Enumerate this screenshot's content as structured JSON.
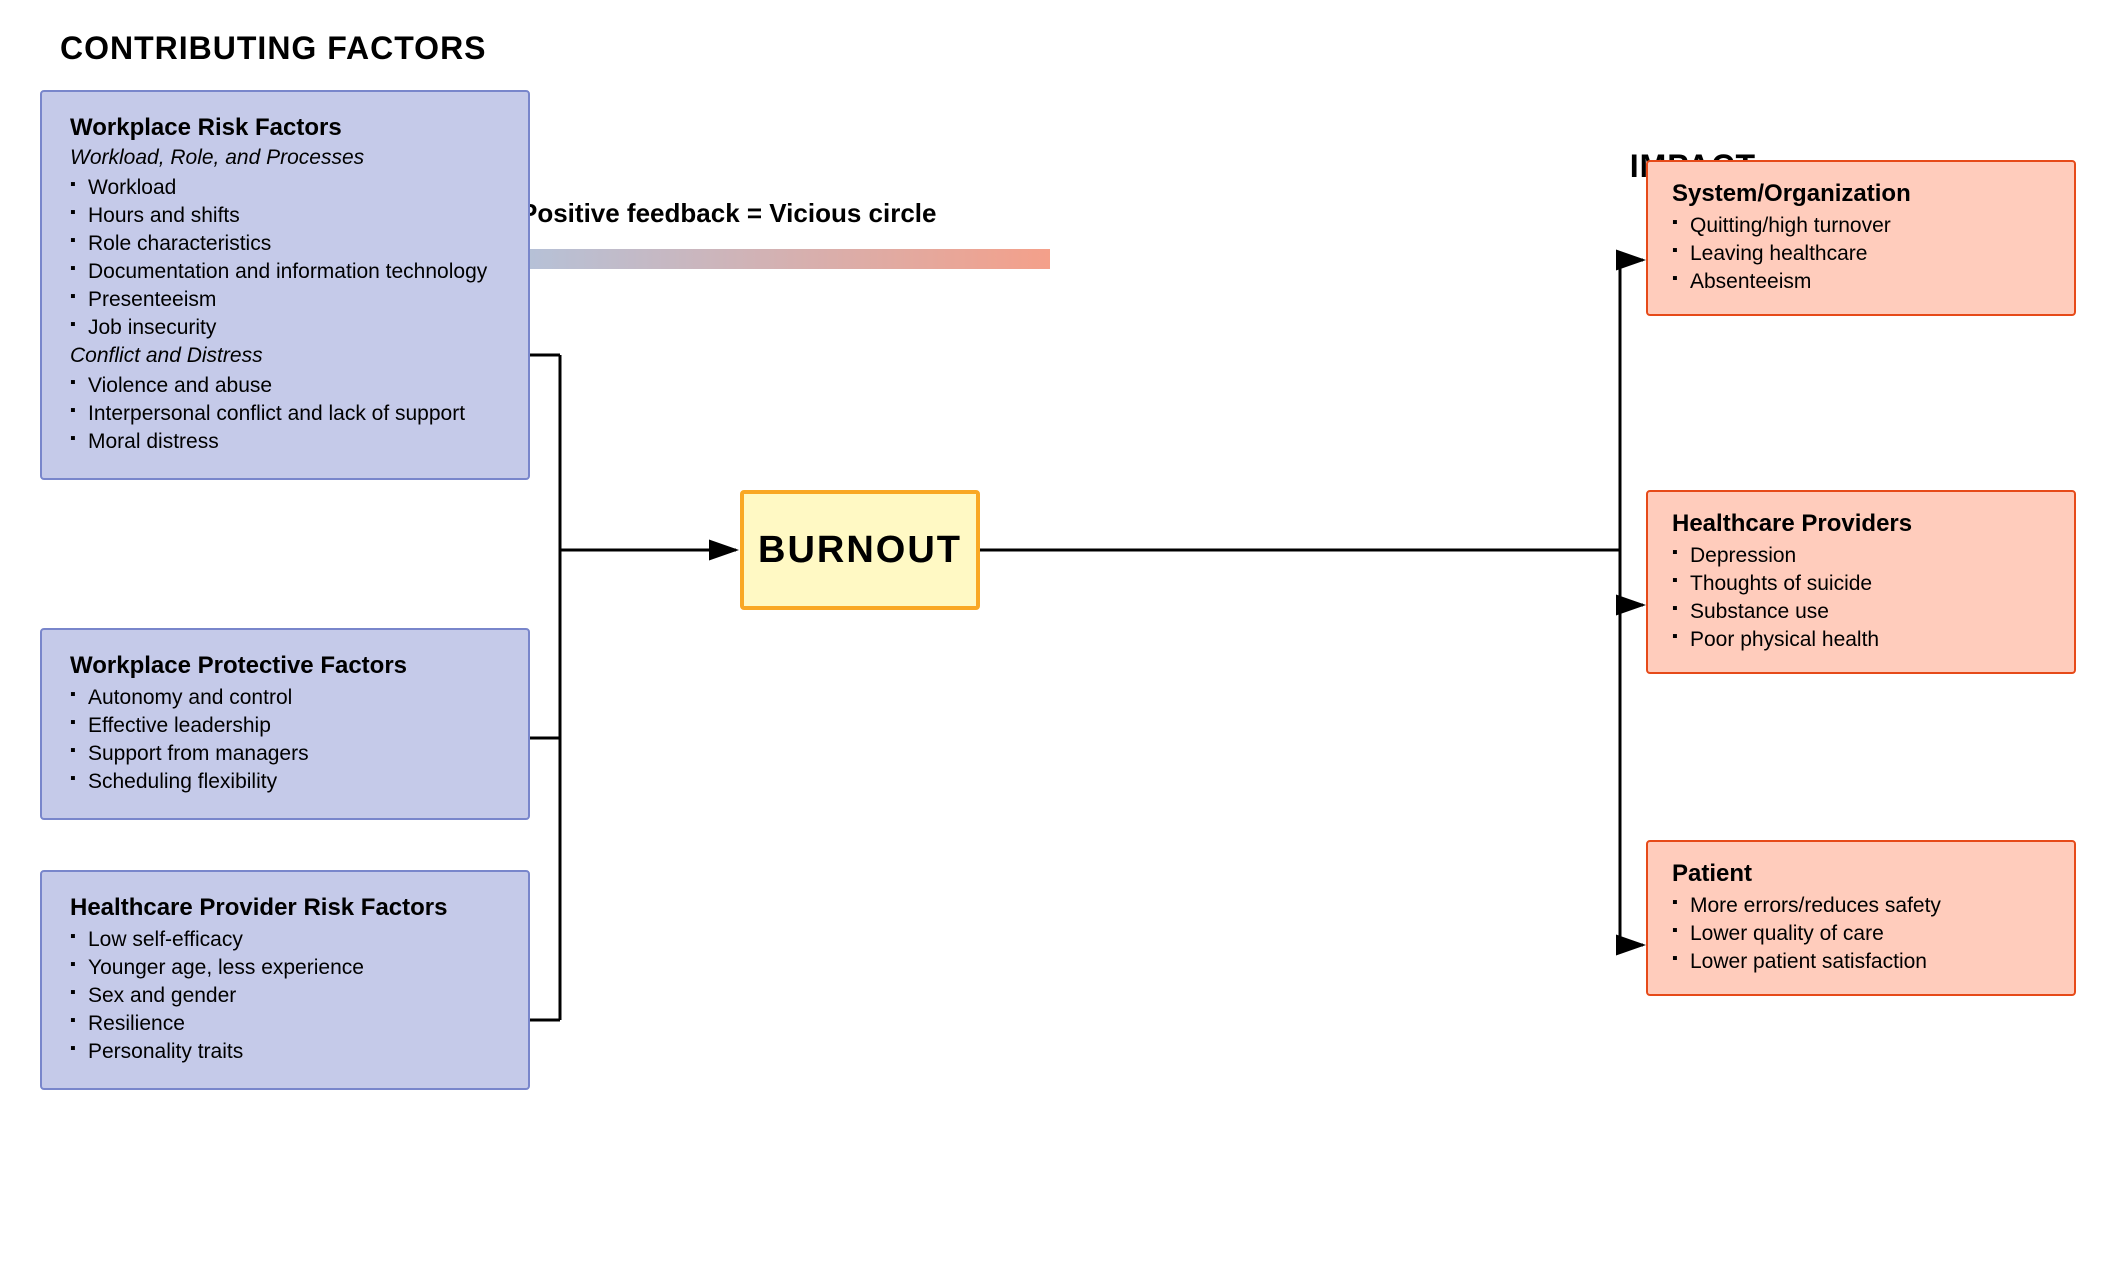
{
  "title": {
    "contributing": "CONTRIBUTING FACTORS",
    "impact": "IMPACT",
    "feedback": "Positive feedback = Vicious circle",
    "burnout": "BURNOUT"
  },
  "boxes": {
    "workplace_risk": {
      "title": "Workplace Risk Factors",
      "subtitle1": "Workload, Role, and Processes",
      "items1": [
        "Workload",
        "Hours and shifts",
        "Role characteristics",
        "Documentation and information technology",
        "Presenteeism",
        "Job insecurity"
      ],
      "subtitle2": "Conflict and Distress",
      "items2": [
        "Violence and abuse",
        "Interpersonal conflict and lack of support",
        "Moral distress"
      ]
    },
    "protective": {
      "title": "Workplace Protective Factors",
      "items": [
        "Autonomy and control",
        "Effective leadership",
        "Support from managers",
        "Scheduling flexibility"
      ]
    },
    "provider_risk": {
      "title": "Healthcare Provider Risk Factors",
      "items": [
        "Low self-efficacy",
        "Younger age, less experience",
        "Sex and gender",
        "Resilience",
        "Personality traits"
      ]
    }
  },
  "impact": {
    "system": {
      "title": "System/Organization",
      "items": [
        "Quitting/high turnover",
        "Leaving healthcare",
        "Absenteeism"
      ]
    },
    "healthcare_providers": {
      "title": "Healthcare Providers",
      "items": [
        "Depression",
        "Thoughts of suicide",
        "Substance use",
        "Poor physical health"
      ]
    },
    "patient": {
      "title": "Patient",
      "items": [
        "More errors/reduces safety",
        "Lower quality of care",
        "Lower patient satisfaction"
      ]
    }
  }
}
